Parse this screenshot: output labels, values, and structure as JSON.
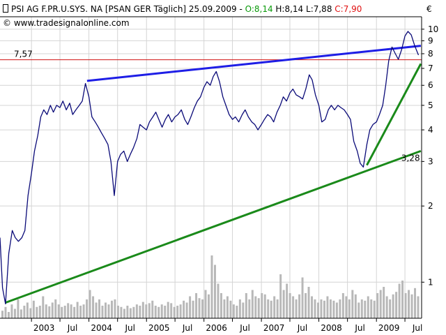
{
  "header": {
    "title_prefix": "PSI AG F.PR.U.SYS. NA [PSAN GER  Täglich] 25.09.2009 - ",
    "open_label": "O:8,14",
    "high_label": " H:8,14 L:7,88 ",
    "close_label": "C:7,90",
    "credit": "© www.tradesignalonline.com",
    "currency_symbol": "€"
  },
  "colors": {
    "price": "#0a0a78",
    "resistance": "#1e1ee6",
    "support": "#1a8a1a",
    "level_line": "#d01010",
    "open_label": "#0a9a0a",
    "close_label": "#e01010",
    "volume": "#b8b8b8",
    "grid": "#d4d4d4"
  },
  "chart_data": {
    "type": "line",
    "y_scale": "log",
    "ylim": [
      0.72,
      11.2
    ],
    "x_range": [
      "2002-06-15",
      "2009-10-15"
    ],
    "y_ticks": [
      1,
      2,
      3,
      4,
      5,
      6,
      7,
      8,
      9,
      10
    ],
    "x_ticks": [
      {
        "label": "2003",
        "date": "2003-01-01"
      },
      {
        "label": "Jul",
        "date": "2003-07-01"
      },
      {
        "label": "2004",
        "date": "2004-01-01"
      },
      {
        "label": "Jul",
        "date": "2004-07-01"
      },
      {
        "label": "2005",
        "date": "2005-01-01"
      },
      {
        "label": "Jul",
        "date": "2005-07-01"
      },
      {
        "label": "2006",
        "date": "2006-01-01"
      },
      {
        "label": "Jul",
        "date": "2006-07-01"
      },
      {
        "label": "2007",
        "date": "2007-01-01"
      },
      {
        "label": "Jul",
        "date": "2007-07-01"
      },
      {
        "label": "2008",
        "date": "2008-01-01"
      },
      {
        "label": "Jul",
        "date": "2008-07-01"
      },
      {
        "label": "2009",
        "date": "2009-01-01"
      },
      {
        "label": "Jul",
        "date": "2009-07-01"
      }
    ],
    "grid": true,
    "series": [
      {
        "x": [
          "2002-06-15",
          "2002-07-01",
          "2002-07-20",
          "2002-08-10",
          "2002-09-01",
          "2002-09-20",
          "2002-10-10",
          "2002-11-01",
          "2002-11-20",
          "2002-12-10",
          "2003-01-01",
          "2003-01-20",
          "2003-02-10",
          "2003-03-01",
          "2003-03-20",
          "2003-04-10",
          "2003-05-01",
          "2003-05-20",
          "2003-06-10",
          "2003-07-01",
          "2003-07-20",
          "2003-08-10",
          "2003-09-01",
          "2003-09-20",
          "2003-10-10",
          "2003-11-01",
          "2003-11-20",
          "2003-12-10",
          "2004-01-01",
          "2004-01-20",
          "2004-02-10",
          "2004-03-01",
          "2004-03-20",
          "2004-04-10",
          "2004-05-01",
          "2004-05-20",
          "2004-06-10",
          "2004-07-01",
          "2004-07-20",
          "2004-08-10",
          "2004-09-01",
          "2004-09-20",
          "2004-10-10",
          "2004-11-01",
          "2004-11-20",
          "2004-12-10",
          "2005-01-01",
          "2005-01-20",
          "2005-02-10",
          "2005-03-01",
          "2005-03-20",
          "2005-04-10",
          "2005-05-01",
          "2005-05-20",
          "2005-06-10",
          "2005-07-01",
          "2005-07-20",
          "2005-08-10",
          "2005-09-01",
          "2005-09-20",
          "2005-10-10",
          "2005-11-01",
          "2005-11-20",
          "2005-12-10",
          "2006-01-01",
          "2006-01-20",
          "2006-02-10",
          "2006-03-01",
          "2006-03-20",
          "2006-04-10",
          "2006-05-01",
          "2006-05-20",
          "2006-06-10",
          "2006-07-01",
          "2006-07-20",
          "2006-08-10",
          "2006-09-01",
          "2006-09-20",
          "2006-10-10",
          "2006-11-01",
          "2006-11-20",
          "2006-12-10",
          "2007-01-01",
          "2007-01-20",
          "2007-02-10",
          "2007-03-01",
          "2007-03-20",
          "2007-04-10",
          "2007-05-01",
          "2007-05-20",
          "2007-06-10",
          "2007-07-01",
          "2007-07-20",
          "2007-08-10",
          "2007-09-01",
          "2007-09-20",
          "2007-10-10",
          "2007-11-01",
          "2007-11-20",
          "2007-12-10",
          "2008-01-01",
          "2008-01-20",
          "2008-02-10",
          "2008-03-01",
          "2008-03-20",
          "2008-04-10",
          "2008-05-01",
          "2008-05-20",
          "2008-06-10",
          "2008-07-01",
          "2008-07-20",
          "2008-08-10",
          "2008-09-01",
          "2008-09-20",
          "2008-10-10",
          "2008-11-01",
          "2008-11-20",
          "2008-12-10",
          "2009-01-01",
          "2009-01-20",
          "2009-02-10",
          "2009-03-01",
          "2009-03-20",
          "2009-04-10",
          "2009-05-01",
          "2009-05-20",
          "2009-06-10",
          "2009-07-01",
          "2009-07-20",
          "2009-08-10",
          "2009-09-01",
          "2009-09-25"
        ],
        "values": [
          1.5,
          0.95,
          0.82,
          1.3,
          1.6,
          1.5,
          1.45,
          1.5,
          1.6,
          2.2,
          2.7,
          3.3,
          3.8,
          4.5,
          4.8,
          4.6,
          5.0,
          4.7,
          5.0,
          4.9,
          5.2,
          4.8,
          5.1,
          4.6,
          4.8,
          5.0,
          5.2,
          6.1,
          5.4,
          4.5,
          4.3,
          4.1,
          3.9,
          3.7,
          3.5,
          3.0,
          2.2,
          3.0,
          3.2,
          3.3,
          3.0,
          3.2,
          3.4,
          3.7,
          4.2,
          4.1,
          4.0,
          4.3,
          4.5,
          4.7,
          4.4,
          4.1,
          4.4,
          4.6,
          4.3,
          4.5,
          4.6,
          4.8,
          4.4,
          4.2,
          4.5,
          4.9,
          5.2,
          5.4,
          5.9,
          6.2,
          6.0,
          6.5,
          6.8,
          6.2,
          5.4,
          5.0,
          4.6,
          4.4,
          4.5,
          4.3,
          4.6,
          4.8,
          4.5,
          4.3,
          4.2,
          4.0,
          4.2,
          4.4,
          4.6,
          4.5,
          4.3,
          4.7,
          5.0,
          5.4,
          5.2,
          5.6,
          5.8,
          5.5,
          5.4,
          5.3,
          5.8,
          6.6,
          6.3,
          5.5,
          5.0,
          4.3,
          4.4,
          4.8,
          5.0,
          4.8,
          5.0,
          4.9,
          4.8,
          4.6,
          4.4,
          3.6,
          3.3,
          2.95,
          2.85,
          3.5,
          4.0,
          4.2,
          4.3,
          4.6,
          5.0,
          6.0,
          7.5,
          8.5,
          8.0,
          7.6,
          8.3,
          9.4,
          9.8,
          9.5,
          8.6,
          7.9
        ]
      }
    ],
    "annotations": [
      {
        "type": "hline",
        "y": 7.57,
        "label": "7,57"
      },
      {
        "type": "trendline",
        "role": "resistance",
        "x": [
          "2003-12-20",
          "2009-10-10"
        ],
        "y": [
          6.25,
          8.6
        ]
      },
      {
        "type": "trendline",
        "role": "long-term-support",
        "x": [
          "2002-07-20",
          "2009-10-10"
        ],
        "y": [
          0.83,
          3.3
        ],
        "label": "3,28"
      },
      {
        "type": "trendline",
        "role": "short-term-support",
        "x": [
          "2008-11-01",
          "2009-10-10"
        ],
        "y": [
          2.9,
          7.3
        ]
      }
    ],
    "volume": [
      0.12,
      0.18,
      0.1,
      0.22,
      0.15,
      0.3,
      0.14,
      0.2,
      0.25,
      0.16,
      0.28,
      0.18,
      0.2,
      0.35,
      0.22,
      0.19,
      0.25,
      0.3,
      0.22,
      0.18,
      0.2,
      0.24,
      0.22,
      0.18,
      0.26,
      0.2,
      0.22,
      0.3,
      0.45,
      0.35,
      0.25,
      0.3,
      0.2,
      0.25,
      0.22,
      0.28,
      0.3,
      0.2,
      0.18,
      0.15,
      0.2,
      0.16,
      0.18,
      0.22,
      0.2,
      0.26,
      0.22,
      0.24,
      0.28,
      0.2,
      0.18,
      0.22,
      0.2,
      0.26,
      0.24,
      0.18,
      0.2,
      0.22,
      0.28,
      0.25,
      0.35,
      0.28,
      0.4,
      0.32,
      0.3,
      0.45,
      0.38,
      1.0,
      0.85,
      0.55,
      0.4,
      0.3,
      0.35,
      0.28,
      0.22,
      0.2,
      0.3,
      0.25,
      0.4,
      0.3,
      0.45,
      0.35,
      0.32,
      0.4,
      0.38,
      0.3,
      0.28,
      0.35,
      0.3,
      0.7,
      0.45,
      0.55,
      0.4,
      0.35,
      0.3,
      0.38,
      0.65,
      0.4,
      0.5,
      0.35,
      0.3,
      0.25,
      0.3,
      0.28,
      0.35,
      0.3,
      0.28,
      0.25,
      0.3,
      0.4,
      0.35,
      0.3,
      0.45,
      0.38,
      0.25,
      0.3,
      0.28,
      0.35,
      0.3,
      0.28,
      0.4,
      0.45,
      0.5,
      0.35,
      0.3,
      0.38,
      0.42,
      0.55,
      0.6,
      0.4,
      0.45,
      0.38,
      0.48,
      0.35
    ]
  }
}
